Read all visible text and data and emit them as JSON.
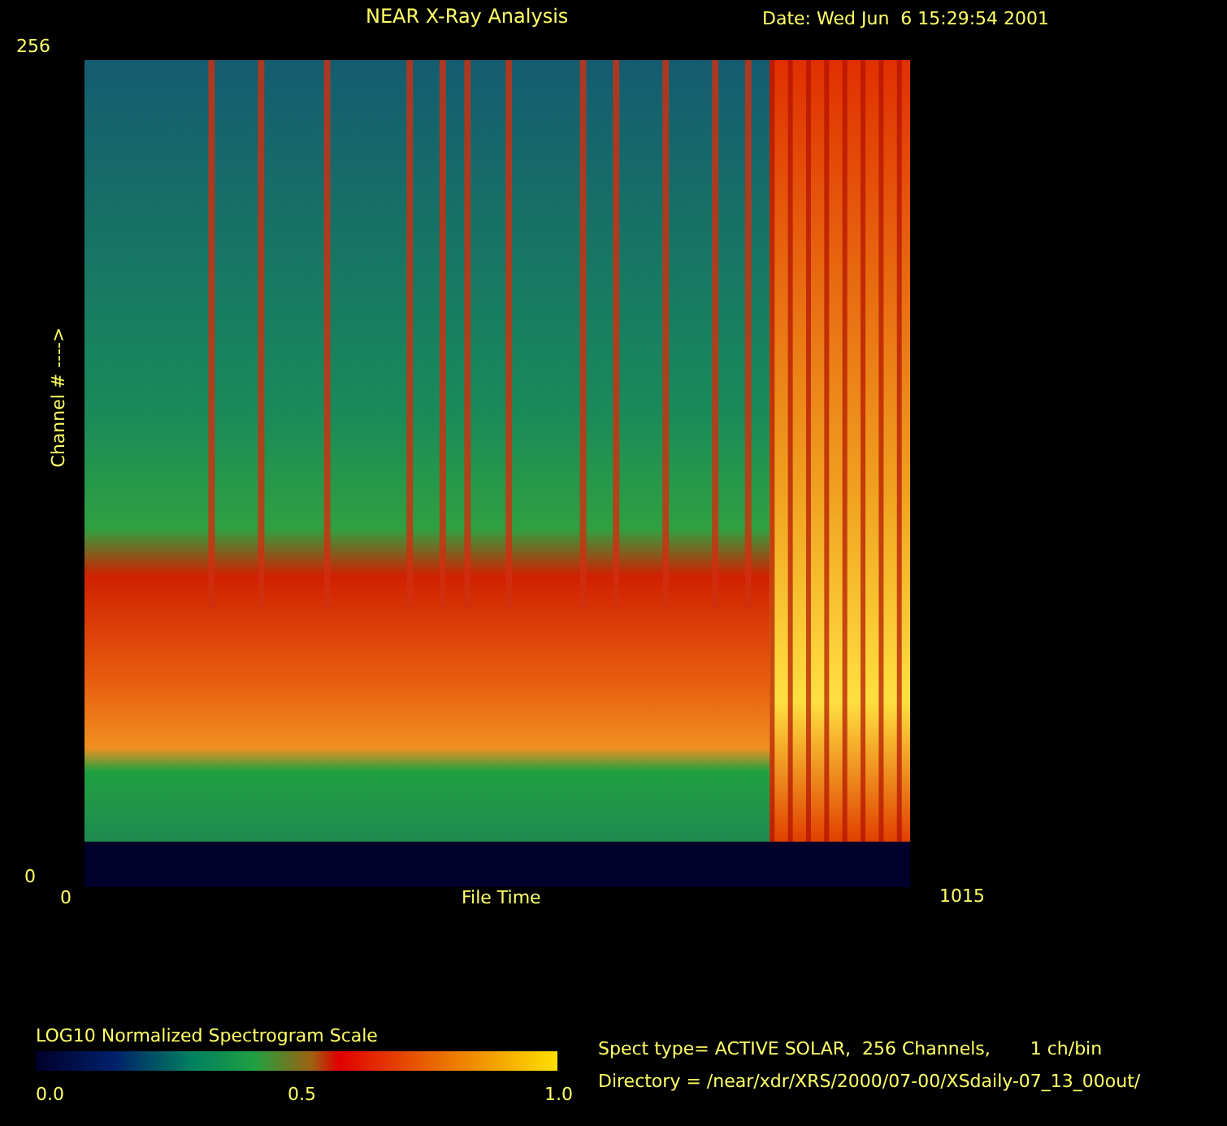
{
  "title": "NEAR X-Ray Analysis",
  "date": "Date: Wed Jun  6 15:29:54 2001",
  "y_axis": {
    "max": "256",
    "min": "0",
    "label": "Channel # ---->"
  },
  "x_axis": {
    "min": "0",
    "label": "File Time",
    "max": "1015"
  },
  "colorbar": {
    "title": "LOG10 Normalized Spectrogram Scale",
    "ticks": [
      "0.0",
      "0.5",
      "1.0"
    ]
  },
  "info": {
    "spect_type": "Spect type= ACTIVE SOLAR,  256 Channels,       1 ch/bin",
    "directory": "Directory = /near/xdr/XRS/2000/07-00/XSdaily-07_13_00out/"
  }
}
